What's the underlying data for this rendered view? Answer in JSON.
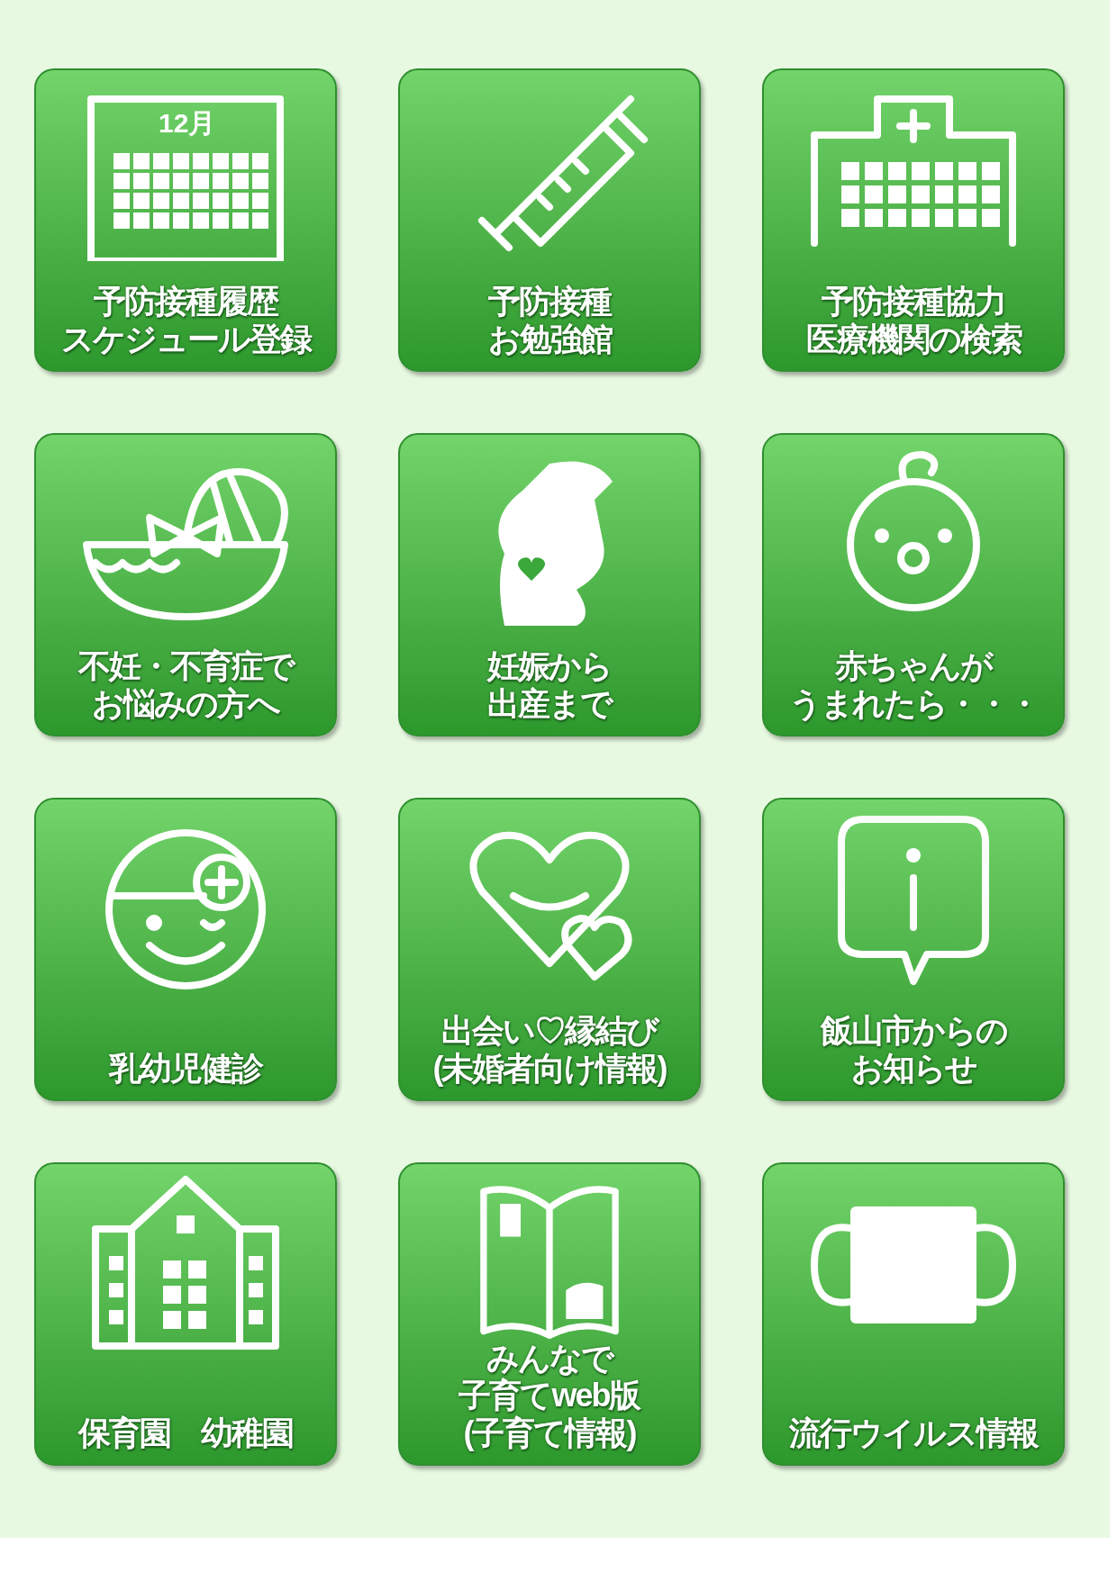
{
  "tiles": [
    {
      "kind": "calendar",
      "icon_text": "12月",
      "lines": [
        "予防接種履歴",
        "スケジュール登録"
      ]
    },
    {
      "kind": "syringe",
      "lines": [
        "予防接種",
        "お勉強館"
      ]
    },
    {
      "kind": "hospital",
      "lines": [
        "予防接種協力",
        "医療機関の検索"
      ]
    },
    {
      "kind": "basket",
      "lines": [
        "不妊・不育症で",
        "お悩みの方へ"
      ]
    },
    {
      "kind": "pregnant",
      "lines": [
        "妊娠から",
        "出産まで"
      ]
    },
    {
      "kind": "baby",
      "lines": [
        "赤ちゃんが",
        "うまれたら・・・"
      ]
    },
    {
      "kind": "checkup",
      "lines": [
        "乳幼児健診"
      ]
    },
    {
      "kind": "hearts",
      "lines": [
        "出会い♡縁結び",
        "(未婚者向け情報)"
      ]
    },
    {
      "kind": "info",
      "lines": [
        "飯山市からの",
        "お知らせ"
      ]
    },
    {
      "kind": "school",
      "lines": [
        "保育園　幼稚園"
      ]
    },
    {
      "kind": "book",
      "lines": [
        "みんなで",
        "子育てweb版",
        "(子育て情報)"
      ]
    },
    {
      "kind": "mask",
      "lines": [
        "流行ウイルス情報"
      ]
    }
  ]
}
